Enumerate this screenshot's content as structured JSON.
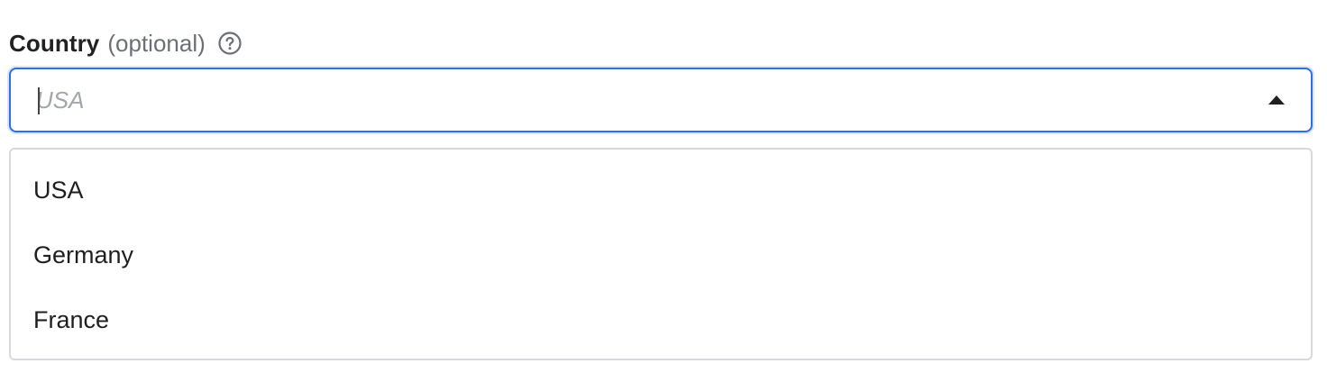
{
  "field": {
    "label": "Country",
    "optional_label": "(optional)",
    "help_icon": "question-circle-icon",
    "input": {
      "value": "",
      "placeholder": "USA",
      "focused": true
    },
    "toggle_icon": "caret-up-icon",
    "expanded": true
  },
  "listbox": {
    "options": [
      {
        "label": "USA"
      },
      {
        "label": "Germany"
      },
      {
        "label": "France"
      }
    ]
  },
  "colors": {
    "focus_ring": "#2f6fe4",
    "list_border": "#d7d9dd",
    "label_muted": "#6b6f76",
    "placeholder": "#a3a6ab",
    "text": "#1f1f1f"
  }
}
